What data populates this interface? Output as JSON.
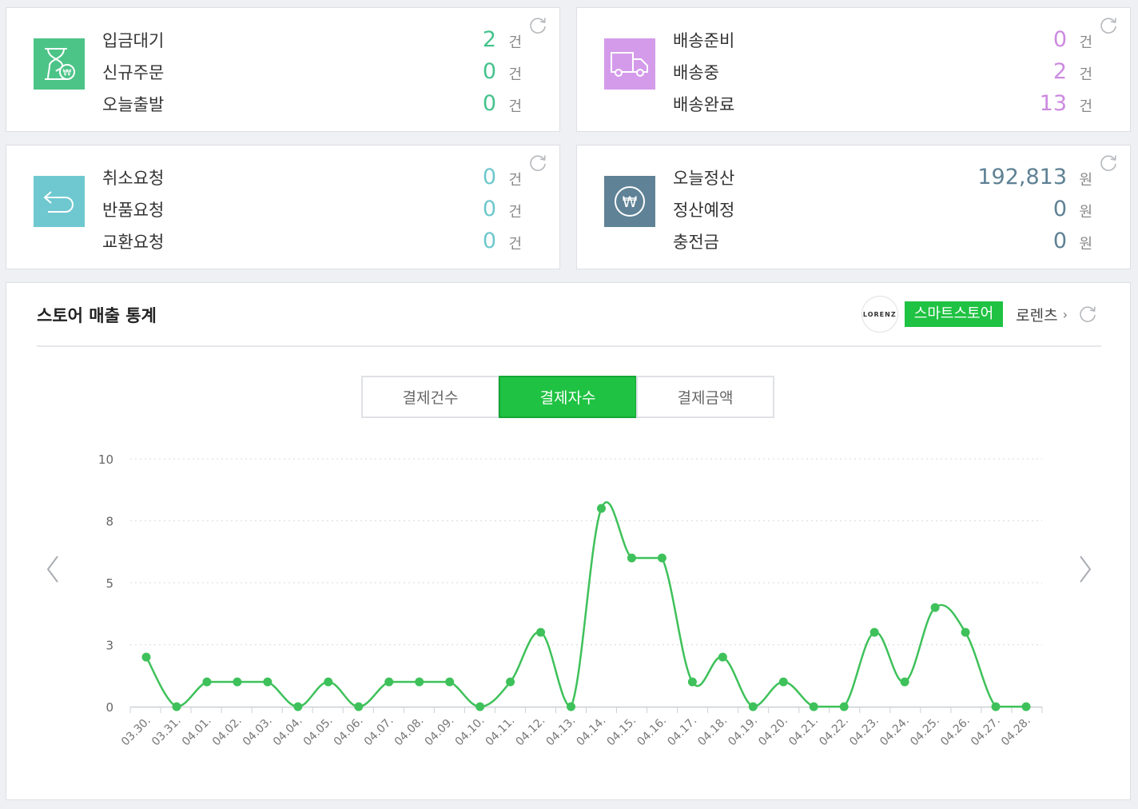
{
  "cards": [
    {
      "icon": "hourglass-won-icon",
      "color": "#4cc487",
      "num_color": "#45c28c",
      "rows": [
        {
          "label": "입금대기",
          "value": "2",
          "unit": "건"
        },
        {
          "label": "신규주문",
          "value": "0",
          "unit": "건"
        },
        {
          "label": "오늘출발",
          "value": "0",
          "unit": "건"
        }
      ]
    },
    {
      "icon": "truck-icon",
      "color": "#d49bea",
      "num_color": "#cc8ae0",
      "rows": [
        {
          "label": "배송준비",
          "value": "0",
          "unit": "건"
        },
        {
          "label": "배송중",
          "value": "2",
          "unit": "건"
        },
        {
          "label": "배송완료",
          "value": "13",
          "unit": "건"
        }
      ]
    },
    {
      "icon": "return-arrow-icon",
      "color": "#6fc8d0",
      "num_color": "#6ec8ce",
      "rows": [
        {
          "label": "취소요청",
          "value": "0",
          "unit": "건"
        },
        {
          "label": "반품요청",
          "value": "0",
          "unit": "건"
        },
        {
          "label": "교환요청",
          "value": "0",
          "unit": "건"
        }
      ]
    },
    {
      "icon": "won-coin-icon",
      "color": "#5f8296",
      "num_color": "#5e8194",
      "rows": [
        {
          "label": "오늘정산",
          "value": "192,813",
          "unit": "원"
        },
        {
          "label": "정산예정",
          "value": "0",
          "unit": "원"
        },
        {
          "label": "충전금",
          "value": "0",
          "unit": "원"
        }
      ]
    }
  ],
  "stats": {
    "title": "스토어 매출 통계",
    "store_logo": "LORENZ",
    "badge": "스마트스토어",
    "store_name": "로렌츠",
    "tabs": [
      "결제건수",
      "결제자수",
      "결제금액"
    ],
    "active_tab": 1
  },
  "chart_data": {
    "type": "line",
    "categories": [
      "03.30.",
      "03.31.",
      "04.01.",
      "04.02.",
      "04.03.",
      "04.04.",
      "04.05.",
      "04.06.",
      "04.07.",
      "04.08.",
      "04.09.",
      "04.10.",
      "04.11.",
      "04.12.",
      "04.13.",
      "04.14.",
      "04.15.",
      "04.16.",
      "04.17.",
      "04.18.",
      "04.19.",
      "04.20.",
      "04.21.",
      "04.22.",
      "04.23.",
      "04.24.",
      "04.25.",
      "04.26.",
      "04.27.",
      "04.28."
    ],
    "values": [
      2,
      0,
      1,
      1,
      1,
      0,
      1,
      0,
      1,
      1,
      1,
      0,
      1,
      3,
      0,
      8,
      6,
      6,
      1,
      2,
      0,
      1,
      0,
      0,
      3,
      1,
      4,
      3,
      0,
      0
    ],
    "y_ticks": [
      "10",
      "8",
      "5",
      "3",
      "0"
    ],
    "ylim": [
      0,
      10
    ],
    "grid": "dotted horizontal",
    "line_color": "#3ec15a"
  }
}
